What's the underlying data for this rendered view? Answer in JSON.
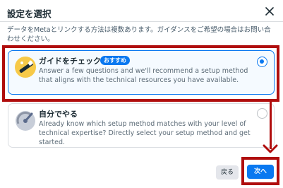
{
  "dialog": {
    "title": "設定を選択",
    "description": "データをMetaとリンクする方法は複数あります。ガイダンスをご希望の場合はお問い合わせください。"
  },
  "options": [
    {
      "title": "ガイドをチェック",
      "badge": "おすすめ",
      "body": "Answer a few questions and we'll recommend a setup method that aligns with the technical resources you have available.",
      "selected": true,
      "icon": "wand-icon"
    },
    {
      "title": "自分でやる",
      "body": "Already know which setup method matches with your level of technical expertise? Directly select your setup method and get started.",
      "selected": false,
      "icon": "gauge-icon"
    }
  ],
  "footer": {
    "back_label": "戻る",
    "next_label": "次へ"
  },
  "colors": {
    "accent": "#0a78f0",
    "annotation": "#b00d0d"
  }
}
